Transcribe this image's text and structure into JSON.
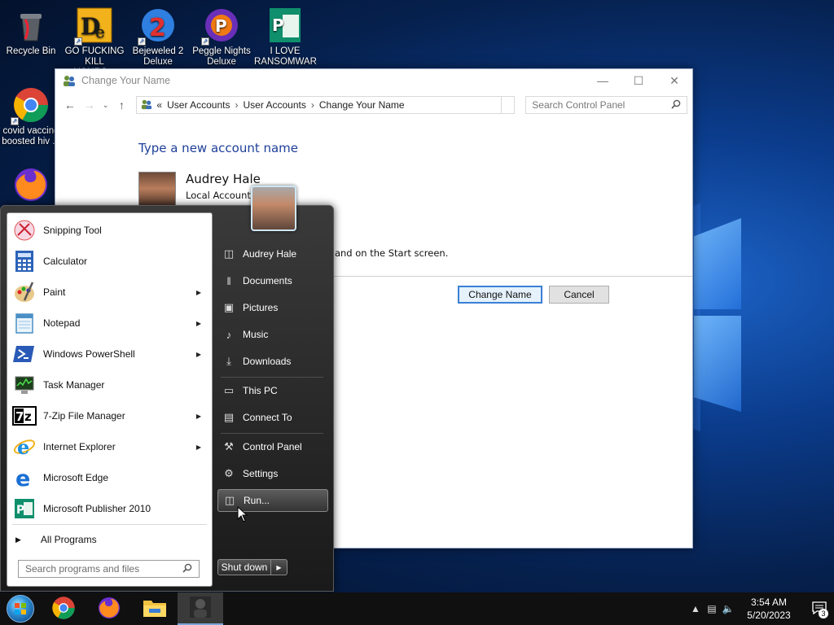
{
  "desktop": {
    "icons": [
      {
        "label": "Recycle Bin"
      },
      {
        "label": "GO FUCKING KILL YOURS..."
      },
      {
        "label": "Bejeweled 2 Deluxe"
      },
      {
        "label": "Peggle Nights Deluxe"
      },
      {
        "label": "I LOVE RANSOMWARE"
      },
      {
        "label": "covid vaccine boosted hiv ..."
      },
      {
        "label": ""
      }
    ]
  },
  "control_panel": {
    "title": "Change Your Name",
    "breadcrumb": {
      "prefix": "«",
      "items": [
        "User Accounts",
        "User Accounts",
        "Change Your Name"
      ]
    },
    "search_placeholder": "Search Control Panel",
    "heading": "Type a new account name",
    "account_name": "Audrey Hale",
    "account_type": "Local Account",
    "hint": "n and on the Start screen.",
    "buttons": {
      "change": "Change Name",
      "cancel": "Cancel"
    }
  },
  "start_menu": {
    "programs": [
      {
        "label": "Snipping Tool",
        "has_submenu": false
      },
      {
        "label": "Calculator",
        "has_submenu": false
      },
      {
        "label": "Paint",
        "has_submenu": true
      },
      {
        "label": "Notepad",
        "has_submenu": true
      },
      {
        "label": "Windows PowerShell",
        "has_submenu": true
      },
      {
        "label": "Task Manager",
        "has_submenu": false
      },
      {
        "label": "7-Zip File Manager",
        "has_submenu": true
      },
      {
        "label": "Internet Explorer",
        "has_submenu": true
      },
      {
        "label": "Microsoft Edge",
        "has_submenu": false
      },
      {
        "label": "Microsoft Publisher 2010",
        "has_submenu": false
      }
    ],
    "all_programs": "All Programs",
    "search_placeholder": "Search programs and files",
    "right": {
      "user": "Audrey Hale",
      "documents": "Documents",
      "pictures": "Pictures",
      "music": "Music",
      "downloads": "Downloads",
      "this_pc": "This PC",
      "connect_to": "Connect To",
      "control_panel": "Control Panel",
      "settings": "Settings",
      "run": "Run..."
    },
    "shutdown": "Shut down"
  },
  "taskbar": {
    "time": "3:54 AM",
    "date": "5/20/2023",
    "notification_count": "3"
  },
  "colors": {
    "accent": "#3a80d6",
    "heading": "#1e3f99",
    "taskbar": "#101010"
  }
}
